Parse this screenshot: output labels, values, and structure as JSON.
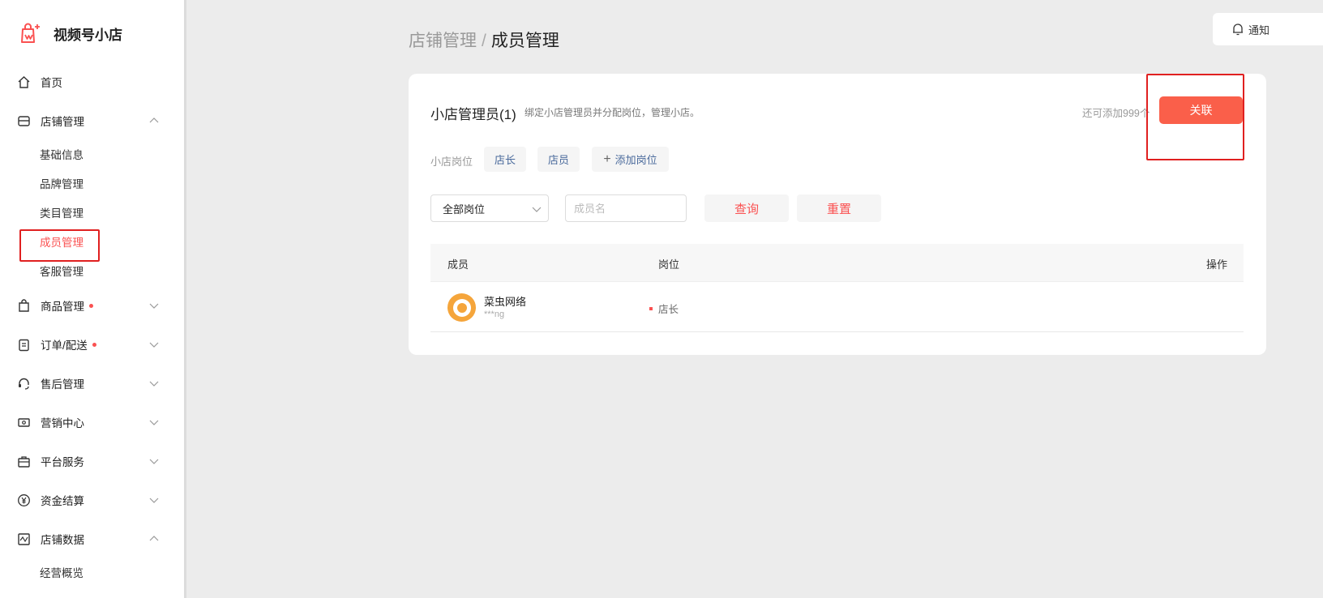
{
  "brand": {
    "title": "视频号小店",
    "accent": "#fa5151"
  },
  "sidebar": {
    "items": [
      {
        "label": "首页",
        "icon": "home-icon",
        "dot": false,
        "chevron": ""
      },
      {
        "label": "店铺管理",
        "icon": "shop-icon",
        "dot": false,
        "chevron": "up"
      },
      {
        "label": "商品管理",
        "icon": "bag-icon",
        "dot": true,
        "chevron": "down"
      },
      {
        "label": "订单/配送",
        "icon": "order-icon",
        "dot": true,
        "chevron": "down"
      },
      {
        "label": "售后管理",
        "icon": "headset-icon",
        "dot": false,
        "chevron": "down"
      },
      {
        "label": "营销中心",
        "icon": "ticket-icon",
        "dot": false,
        "chevron": "down"
      },
      {
        "label": "平台服务",
        "icon": "briefcase-icon",
        "dot": false,
        "chevron": "down"
      },
      {
        "label": "资金结算",
        "icon": "yen-icon",
        "dot": false,
        "chevron": "down"
      },
      {
        "label": "店铺数据",
        "icon": "chart-icon",
        "dot": false,
        "chevron": "up"
      }
    ],
    "shop_sub": [
      "基础信息",
      "品牌管理",
      "类目管理",
      "成员管理",
      "客服管理"
    ],
    "shop_sub_active": "成员管理",
    "data_sub": [
      "经营概览"
    ]
  },
  "notice": {
    "label": "通知"
  },
  "breadcrumb": {
    "parent": "店铺管理",
    "separator": "/",
    "current": "成员管理"
  },
  "card": {
    "title": "小店管理员(1)",
    "desc": "绑定小店管理员并分配岗位，管理小店。",
    "quota": "还可添加999个",
    "link_button": "关联",
    "roles_label": "小店岗位",
    "roles": [
      "店长",
      "店员"
    ],
    "add_role": "添加岗位",
    "filter": {
      "select_value": "全部岗位",
      "name_placeholder": "成员名",
      "query_button": "查询",
      "reset_button": "重置"
    },
    "table": {
      "headers": {
        "member": "成员",
        "role": "岗位",
        "action": "操作"
      },
      "rows": [
        {
          "name": "菜虫网络",
          "sub": "***ng",
          "role": "店长"
        }
      ]
    }
  }
}
